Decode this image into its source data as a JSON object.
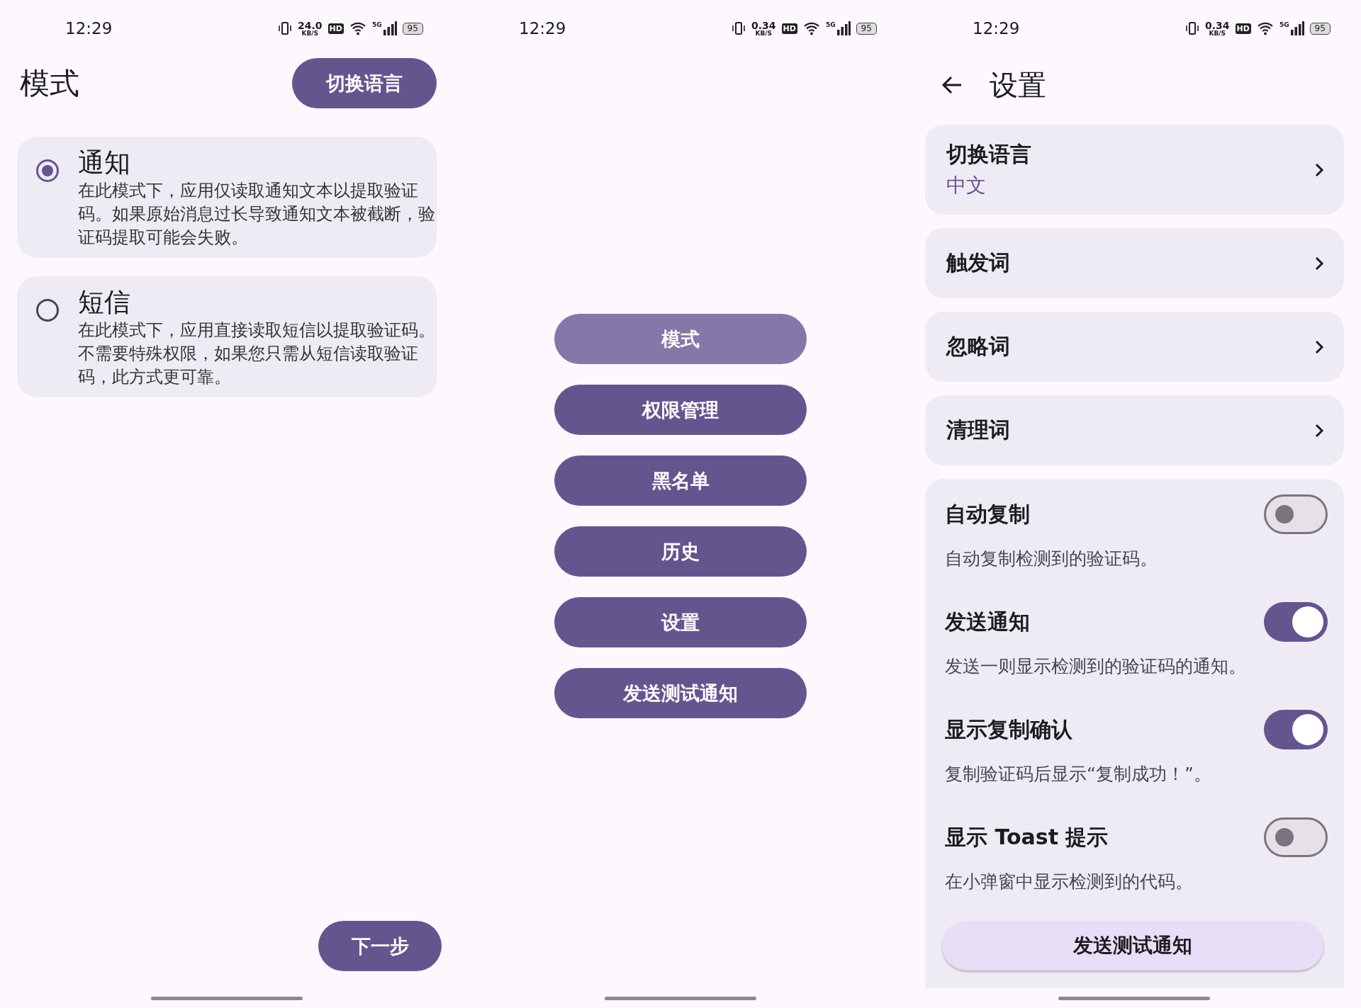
{
  "screens": [
    {
      "kind": "mode",
      "status_bar": {
        "time": "12:29",
        "speed": "24.0",
        "speed_unit": "KB/S",
        "hd": "HD",
        "network": "5G",
        "battery": "95"
      },
      "title": "模式",
      "language_button": "切换语言",
      "options": [
        {
          "title": "通知",
          "description": "在此模式下，应用仅读取通知文本以提取验证码。如果原始消息过长导致通知文本被截断，验证码提取可能会失败。",
          "selected": true
        },
        {
          "title": "短信",
          "description": "在此模式下，应用直接读取短信以提取验证码。不需要特殊权限，如果您只需从短信读取验证码，此方式更可靠。",
          "selected": false
        }
      ],
      "next_button": "下一步"
    },
    {
      "kind": "menu",
      "status_bar": {
        "time": "12:29",
        "speed": "0.34",
        "speed_unit": "KB/S",
        "hd": "HD",
        "network": "5G",
        "battery": "95"
      },
      "buttons": [
        {
          "label": "模式",
          "disabled": true
        },
        {
          "label": "权限管理",
          "disabled": false
        },
        {
          "label": "黑名单",
          "disabled": false
        },
        {
          "label": "历史",
          "disabled": false
        },
        {
          "label": "设置",
          "disabled": false
        },
        {
          "label": "发送测试通知",
          "disabled": false
        }
      ]
    },
    {
      "kind": "settings",
      "status_bar": {
        "time": "12:29",
        "speed": "0.34",
        "speed_unit": "KB/S",
        "hd": "HD",
        "network": "5G",
        "battery": "95"
      },
      "title": "设置",
      "nav_items": [
        {
          "title": "切换语言",
          "subtitle": "中文"
        },
        {
          "title": "触发词"
        },
        {
          "title": "忽略词"
        },
        {
          "title": "清理词"
        }
      ],
      "toggles": [
        {
          "title": "自动复制",
          "description": "自动复制检测到的验证码。",
          "on": false
        },
        {
          "title": "发送通知",
          "description": "发送一则显示检测到的验证码的通知。",
          "on": true
        },
        {
          "title": "显示复制确认",
          "description": "复制验证码后显示“复制成功！”。",
          "on": true
        },
        {
          "title": "显示 Toast 提示",
          "description": "在小弹窗中显示检测到的代码。",
          "on": false
        }
      ],
      "test_button": "发送测试通知"
    }
  ]
}
